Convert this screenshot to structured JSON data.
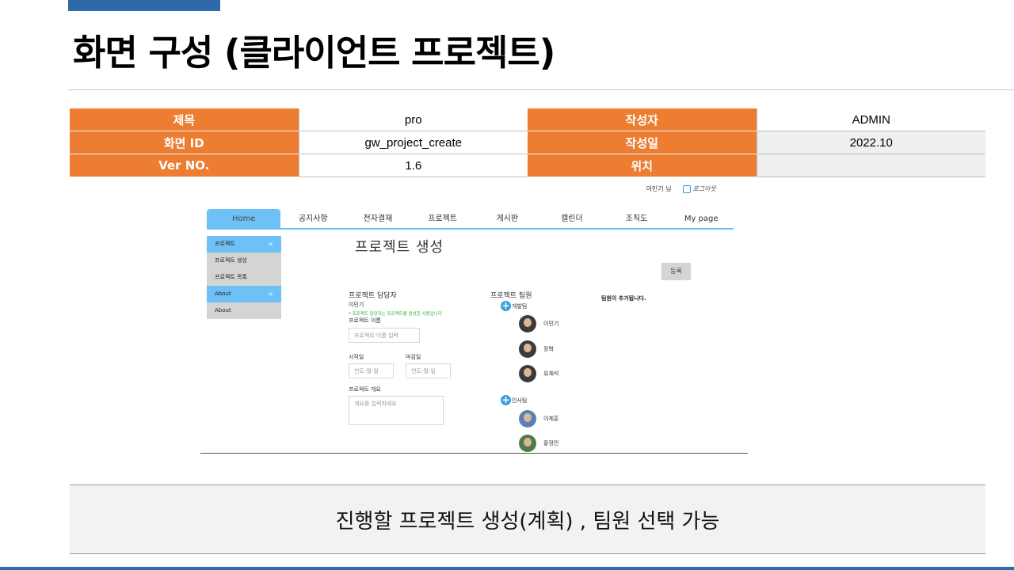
{
  "slide": {
    "title": "화면 구성 (클라이언트 프로젝트)",
    "summary": "진행할 프로젝트 생성(계획) , 팀원 선택 가능"
  },
  "info_table": {
    "rows": [
      {
        "k1": "제목",
        "v1": "pro",
        "k2": "작성자",
        "v2": "ADMIN"
      },
      {
        "k1": "화면 ID",
        "v1": "gw_project_create",
        "k2": "작성일",
        "v2": "2022.10"
      },
      {
        "k1": "Ver NO.",
        "v1": "1.6",
        "k2": "위치",
        "v2": ""
      }
    ]
  },
  "mockup": {
    "user_name": "이민기 님",
    "logout_label": "로그아웃",
    "nav_tabs": [
      "Home",
      "공지사항",
      "전자결재",
      "프로젝트",
      "게시판",
      "캘린더",
      "조직도",
      "My page"
    ],
    "side_menu": [
      {
        "label": "프로젝트",
        "type": "header",
        "close": "×"
      },
      {
        "label": "프로젝트 생성",
        "type": "item"
      },
      {
        "label": "프로젝트 목록",
        "type": "item"
      },
      {
        "label": "About",
        "type": "header",
        "close": "×"
      },
      {
        "label": "About",
        "type": "item"
      }
    ],
    "page_heading": "프로젝트 생성",
    "register_button": "등록",
    "form": {
      "manager_label": "프로젝트 담당자",
      "manager_value": "이민기",
      "manager_note": "* 프로젝트 담당자는 프로젝트를 생성한 사용입니다",
      "name_label": "프로젝트 이름",
      "name_placeholder": "프로젝트 이름 입력",
      "start_label": "시작일",
      "start_placeholder": "연도-월-일",
      "end_label": "마감일",
      "end_placeholder": "연도-월-일",
      "summary_label": "프로젝트 개요",
      "summary_placeholder": "개요를 입력하세요"
    },
    "team": {
      "title": "프로젝트 팀원",
      "added_message": "팀원이 추가됩니다.",
      "groups": [
        {
          "name": "개발팀",
          "members": [
            "이민기",
            "장혁",
            "유재석"
          ]
        },
        {
          "name": "인사팀",
          "members": [
            "이제훈",
            "황정민"
          ]
        }
      ]
    }
  }
}
